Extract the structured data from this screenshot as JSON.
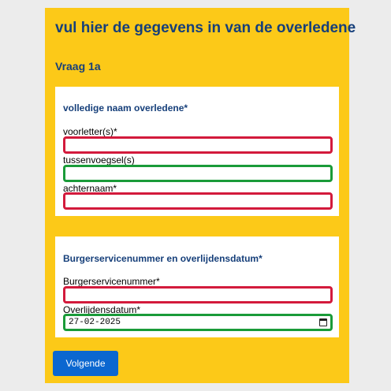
{
  "form": {
    "title": "vul hier de gegevens in van de overledene",
    "question": "Vraag 1a",
    "name_section": {
      "title": "volledige naam overledene*",
      "fields": [
        {
          "label": "voorletter(s)*",
          "value": "",
          "state": "invalid"
        },
        {
          "label": "tussenvoegsel(s)",
          "value": "",
          "state": "valid"
        },
        {
          "label": "achternaam*",
          "value": "",
          "state": "invalid"
        }
      ]
    },
    "bsn_section": {
      "title": "Burgerservicenummer en overlijdensdatum*",
      "bsn": {
        "label": "Burgerservicenummer*",
        "value": "",
        "state": "invalid"
      },
      "date": {
        "label": "Overlijdensdatum*",
        "value": "27-02-2025",
        "state": "valid"
      }
    },
    "next_button_label": "Volgende"
  },
  "colors": {
    "panel": "#fcc918",
    "heading": "#163f7a",
    "invalid_border": "#d31a3c",
    "valid_border": "#1a9b39",
    "button": "#0b67d0"
  },
  "icons": {
    "date_picker": "calendar-icon"
  }
}
